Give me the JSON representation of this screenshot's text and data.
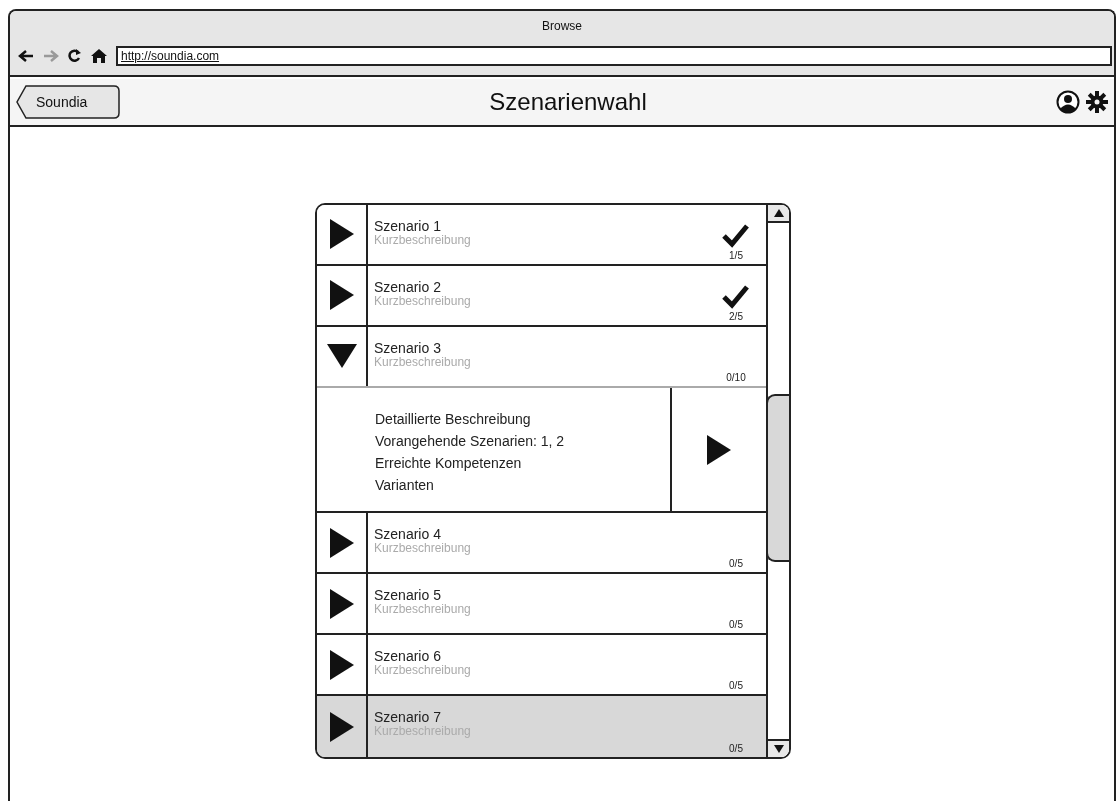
{
  "window": {
    "title": "Browse"
  },
  "address_bar": {
    "url": "http://soundia.com"
  },
  "nav_bar": {
    "back_label": "Soundia",
    "title": "Szenarienwahl"
  },
  "scenarios": [
    {
      "name": "Szenario 1",
      "subtitle": "Kurzbeschreibung",
      "progress": "1/5",
      "completed": true,
      "expanded": false,
      "selected": false
    },
    {
      "name": "Szenario 2",
      "subtitle": "Kurzbeschreibung",
      "progress": "2/5",
      "completed": true,
      "expanded": false,
      "selected": false
    },
    {
      "name": "Szenario 3",
      "subtitle": "Kurzbeschreibung",
      "progress": "0/10",
      "completed": false,
      "expanded": true,
      "selected": false,
      "details": [
        "Detaillierte Beschreibung",
        "Vorangehende Szenarien: 1, 2",
        "Erreichte Kompetenzen",
        "Varianten"
      ]
    },
    {
      "name": "Szenario 4",
      "subtitle": "Kurzbeschreibung",
      "progress": "0/5",
      "completed": false,
      "expanded": false,
      "selected": false
    },
    {
      "name": "Szenario 5",
      "subtitle": "Kurzbeschreibung",
      "progress": "0/5",
      "completed": false,
      "expanded": false,
      "selected": false
    },
    {
      "name": "Szenario 6",
      "subtitle": "Kurzbeschreibung",
      "progress": "0/5",
      "completed": false,
      "expanded": false,
      "selected": false
    },
    {
      "name": "Szenario 7",
      "subtitle": "Kurzbeschreibung",
      "progress": "0/5",
      "completed": false,
      "expanded": false,
      "selected": true
    }
  ]
}
